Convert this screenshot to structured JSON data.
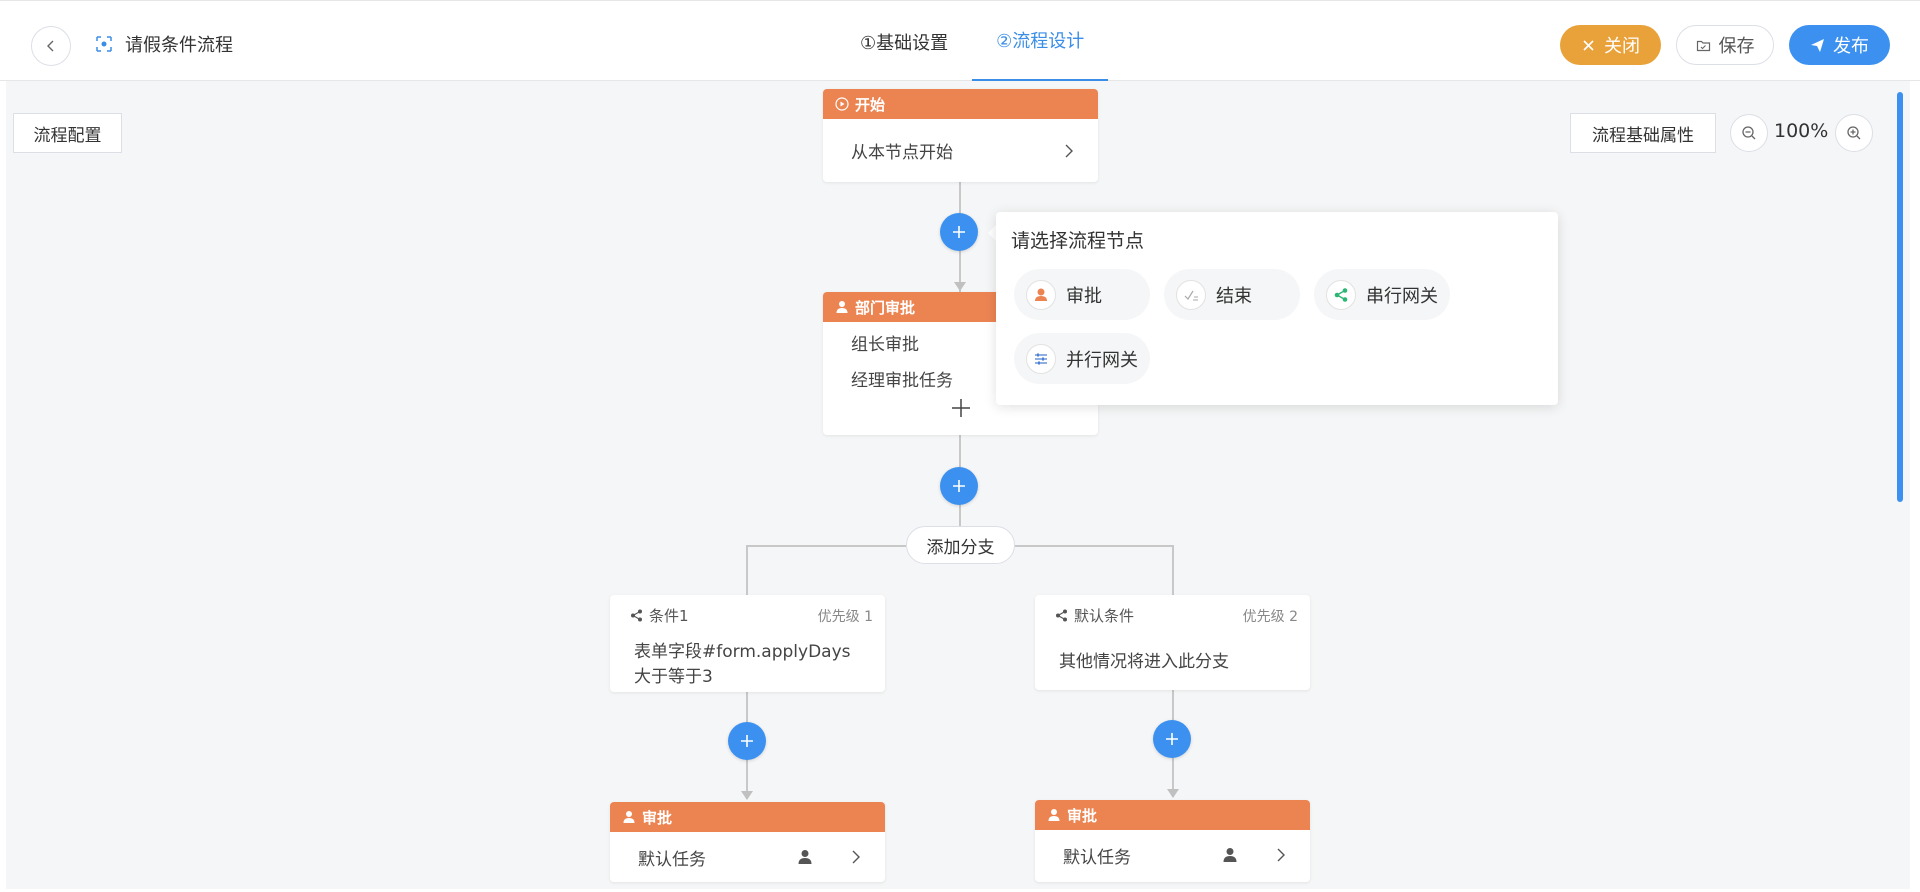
{
  "header": {
    "title": "请假条件流程",
    "tabs": [
      "①基础设置",
      "②流程设计"
    ],
    "close_label": "关闭",
    "save_label": "保存",
    "publish_label": "发布",
    "accent": "#3a8ee6"
  },
  "canvas": {
    "config_label": "流程配置",
    "props_label": "流程基础属性",
    "zoom": "100%"
  },
  "start_node": {
    "header": "开始",
    "text": "从本节点开始"
  },
  "dept_node": {
    "header": "部门审批",
    "tasks": [
      "组长审批",
      "经理审批任务"
    ]
  },
  "add_branch_label": "添加分支",
  "branches": [
    {
      "name": "条件1",
      "priority": "优先级 1",
      "text": "表单字段#form.applyDays大于等于3"
    },
    {
      "name": "默认条件",
      "priority": "优先级 2",
      "text": "其他情况将进入此分支"
    }
  ],
  "branch_nodes": [
    {
      "header": "审批",
      "task": "默认任务"
    },
    {
      "header": "审批",
      "task": "默认任务"
    }
  ],
  "popover": {
    "title": "请选择流程节点",
    "items": [
      {
        "label": "审批",
        "icon": "approver-icon"
      },
      {
        "label": "结束",
        "icon": "end-icon"
      },
      {
        "label": "串行网关",
        "icon": "share-icon"
      },
      {
        "label": "并行网关",
        "icon": "sliders-icon"
      }
    ]
  },
  "colors": {
    "node_header": "#ec8452",
    "plus": "#3c91f0",
    "close_btn": "#e9a13a",
    "publish_btn": "#3c91f0"
  }
}
